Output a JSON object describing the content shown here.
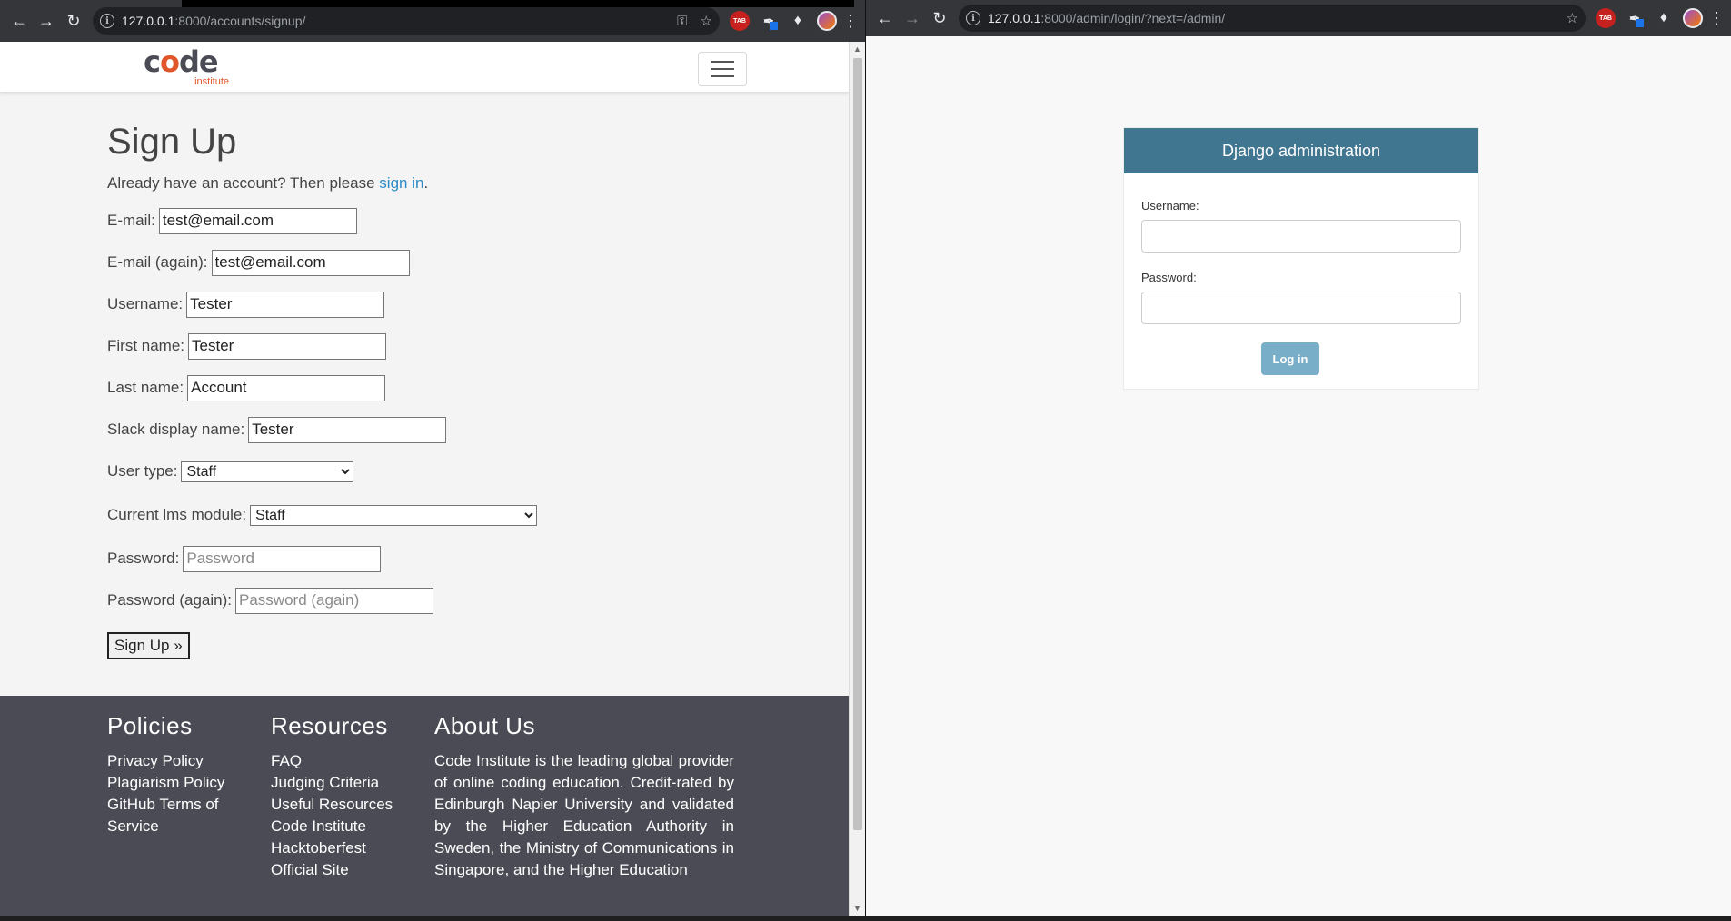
{
  "left_browser": {
    "url_host": "127.0.0.1",
    "url_path": ":8000/accounts/signup/"
  },
  "right_browser": {
    "url_host": "127.0.0.1",
    "url_path": ":8000/admin/login/?next=/admin/"
  },
  "navbar": {
    "logo_word_c": "c",
    "logo_word_o": "o",
    "logo_word_de": "de",
    "logo_sub": "institute"
  },
  "signup": {
    "title": "Sign Up",
    "intro_prefix": "Already have an account? Then please ",
    "intro_link": "sign in",
    "intro_suffix": ".",
    "fields": {
      "email_label": "E-mail:",
      "email_value": "test@email.com",
      "email2_label": "E-mail (again):",
      "email2_value": "test@email.com",
      "username_label": "Username:",
      "username_value": "Tester",
      "first_name_label": "First name:",
      "first_name_value": "Tester",
      "last_name_label": "Last name:",
      "last_name_value": "Account",
      "slack_label": "Slack display name:",
      "slack_value": "Tester",
      "user_type_label": "User type:",
      "user_type_value": "Staff",
      "lms_label": "Current lms module:",
      "lms_value": "Staff",
      "password_label": "Password:",
      "password_placeholder": "Password",
      "password2_label": "Password (again):",
      "password2_placeholder": "Password (again)"
    },
    "submit_label": "Sign Up »"
  },
  "footer": {
    "policies_heading": "Policies",
    "policies_links": [
      "Privacy Policy",
      "Plagiarism Policy",
      "GitHub Terms of Service"
    ],
    "resources_heading": "Resources",
    "resources_links": [
      "FAQ",
      "Judging Criteria",
      "Useful Resources",
      "Code Institute Hacktoberfest Official Site"
    ],
    "about_heading": "About Us",
    "about_text": "Code Institute is the leading global provider of online coding education. Credit-rated by Edinburgh Napier University and validated by the Higher Education Authority in Sweden, the Ministry of Communications in Singapore, and the Higher Education"
  },
  "admin": {
    "header": "Django administration",
    "username_label": "Username:",
    "password_label": "Password:",
    "login_label": "Log in"
  },
  "colors": {
    "admin_header": "#417690",
    "admin_button": "#79aec8",
    "footer_bg": "#4b4b55",
    "logo_accent": "#e0562a",
    "link": "#2b8bc7"
  }
}
